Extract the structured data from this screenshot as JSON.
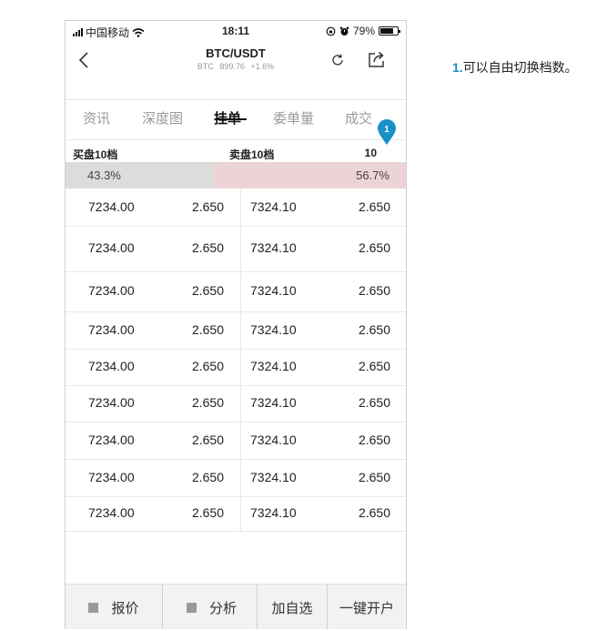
{
  "status_bar": {
    "carrier": "中国移动",
    "time": "18:11",
    "battery": "79%",
    "battery_level": 0.79
  },
  "nav": {
    "title": "BTC/USDT",
    "sub_symbol": "BTC",
    "sub_price": "899.76",
    "sub_change": "+1.6%"
  },
  "tabs": [
    {
      "label": "资讯"
    },
    {
      "label": "深度图"
    },
    {
      "label": "挂单"
    },
    {
      "label": "委单量"
    },
    {
      "label": "成交"
    }
  ],
  "order_book": {
    "buy_label": "买盘10档",
    "sell_label": "卖盘10档",
    "depth_value": "10",
    "marker_number": "1",
    "buy_ratio": "43.3%",
    "sell_ratio": "56.7%",
    "rows": [
      {
        "bid_price": "7234.00",
        "bid_qty": "2.650",
        "ask_price": "7324.10",
        "ask_qty": "2.650"
      },
      {
        "bid_price": "7234.00",
        "bid_qty": "2.650",
        "ask_price": "7324.10",
        "ask_qty": "2.650"
      },
      {
        "bid_price": "7234.00",
        "bid_qty": "2.650",
        "ask_price": "7324.10",
        "ask_qty": "2.650"
      },
      {
        "bid_price": "7234.00",
        "bid_qty": "2.650",
        "ask_price": "7324.10",
        "ask_qty": "2.650"
      },
      {
        "bid_price": "7234.00",
        "bid_qty": "2.650",
        "ask_price": "7324.10",
        "ask_qty": "2.650"
      },
      {
        "bid_price": "7234.00",
        "bid_qty": "2.650",
        "ask_price": "7324.10",
        "ask_qty": "2.650"
      },
      {
        "bid_price": "7234.00",
        "bid_qty": "2.650",
        "ask_price": "7324.10",
        "ask_qty": "2.650"
      },
      {
        "bid_price": "7234.00",
        "bid_qty": "2.650",
        "ask_price": "7324.10",
        "ask_qty": "2.650"
      },
      {
        "bid_price": "7234.00",
        "bid_qty": "2.650",
        "ask_price": "7324.10",
        "ask_qty": "2.650"
      }
    ]
  },
  "bottom_bar": {
    "quote": "报价",
    "analysis": "分析",
    "add_watchlist": "加自选",
    "open_account": "一键开户"
  },
  "annotation": {
    "number": "1.",
    "text": "可以自由切换档数。"
  },
  "colors": {
    "buy_bar": "#dcdcdc",
    "sell_bar": "#ecd3d6",
    "marker": "#1a8fc9",
    "annotation_number": "#1a8fc9"
  },
  "icons": [
    "wifi-icon",
    "alarm-icon",
    "lock-rotation-icon",
    "battery-icon",
    "back-icon",
    "refresh-icon",
    "share-icon",
    "marker-icon"
  ]
}
